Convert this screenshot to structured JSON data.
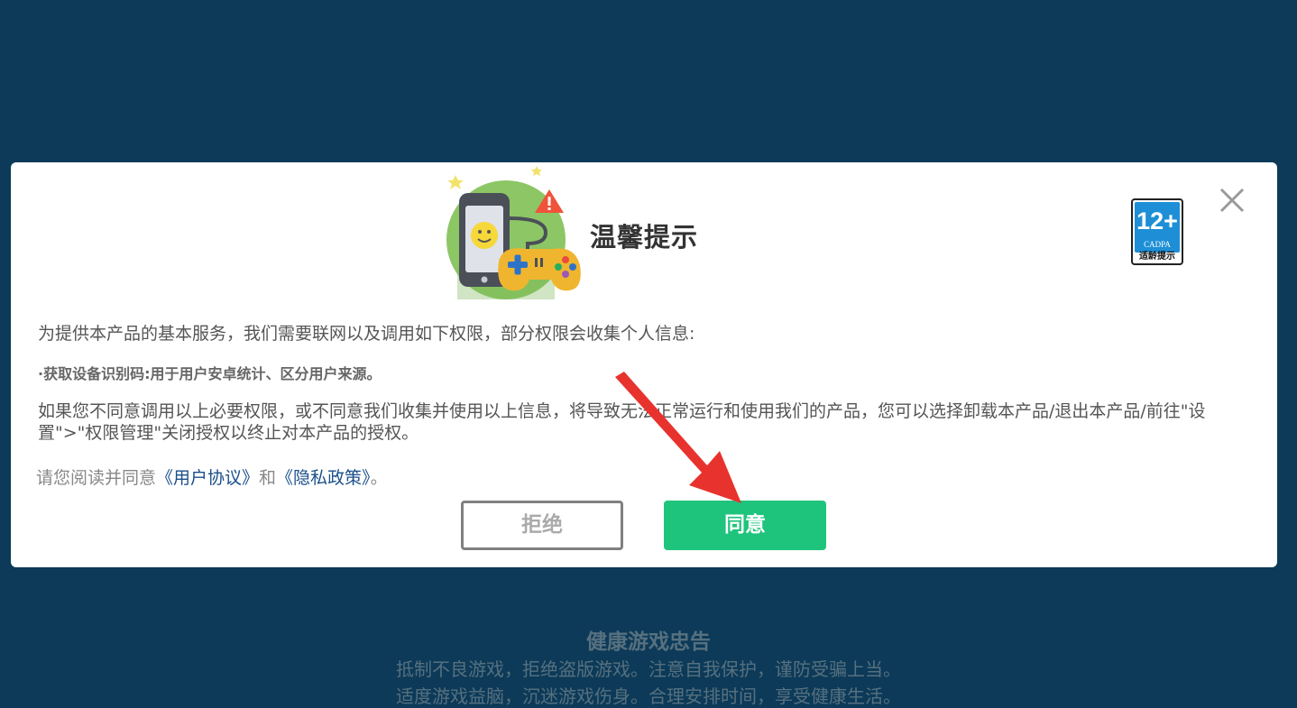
{
  "dialog": {
    "title": "温馨提示",
    "age_badge": {
      "age": "12+",
      "org": "CADPA",
      "caption": "适龄提示"
    },
    "intro": "为提供本产品的基本服务，我们需要联网以及调用如下权限，部分权限会收集个人信息:",
    "permission_item": "·获取设备识别码:用于用户安卓统计、区分用户来源。",
    "refusal_text": "如果您不同意调用以上必要权限，或不同意我们收集并使用以上信息，将导致无法正常运行和使用我们的产品，您可以选择卸载本产品/退出本产品/前往\"设置\">\"权限管理\"关闭授权以终止对本产品的授权。",
    "agree_prefix": "请您阅读并同意",
    "user_agreement_link": "《用户协议》",
    "and_text": "和",
    "privacy_policy_link": "《隐私政策》",
    "end_punct": "。",
    "reject_label": "拒绝",
    "agree_label": "同意"
  },
  "health_notice": {
    "title": "健康游戏忠告",
    "line1": "抵制不良游戏，拒绝盗版游戏。注意自我保护，谨防受骗上当。",
    "line2": "适度游戏益脑，沉迷游戏伤身。合理安排时间，享受健康生活。"
  },
  "colors": {
    "background": "#0c3a58",
    "agree_button": "#1fc47c",
    "link": "#1a4f8a",
    "arrow": "#e8322e"
  },
  "icons": {
    "hero": "phone-gamepad-icon",
    "close": "close-icon",
    "arrow": "red-arrow-annotation"
  }
}
